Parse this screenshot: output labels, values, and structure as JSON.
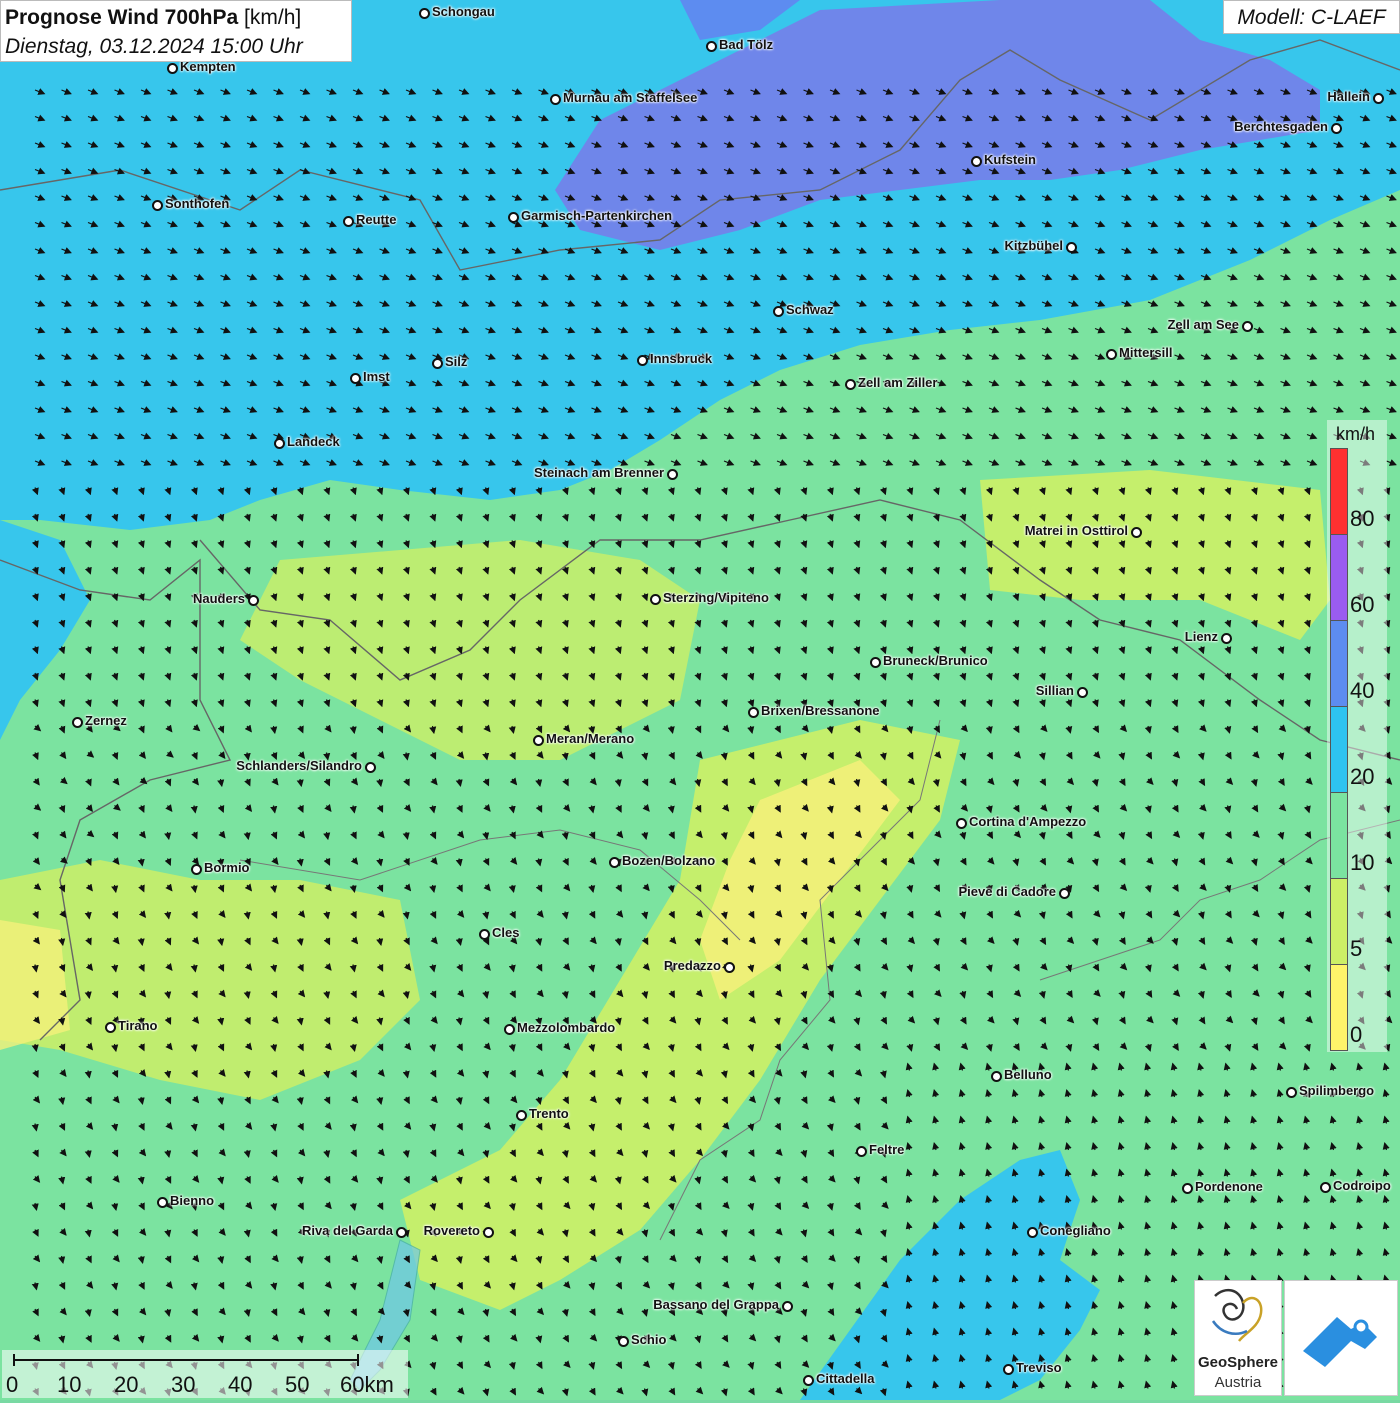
{
  "header": {
    "title_bold": "Prognose Wind 700hPa",
    "title_unit": " [km/h]",
    "datetime": "Dienstag, 03.12.2024 15:00 Uhr",
    "model": "Modell: C-LAEF"
  },
  "legend": {
    "unit": "km/h",
    "ticks": [
      "80",
      "60",
      "40",
      "20",
      "10",
      "5",
      "0"
    ],
    "colors": [
      "#ff3030",
      "#9a5cf0",
      "#5d8cf0",
      "#2ec3f0",
      "#7be3a0",
      "#cdef66",
      "#fff46a"
    ]
  },
  "scale": {
    "labels": [
      "0",
      "10",
      "20",
      "30",
      "40",
      "50",
      "60km"
    ]
  },
  "cities": [
    {
      "name": "Schongau"
    },
    {
      "name": "Bad Tölz"
    },
    {
      "name": "Kempten"
    },
    {
      "name": "Murnau am Staffelsee"
    },
    {
      "name": "Hallein"
    },
    {
      "name": "Berchtesgaden"
    },
    {
      "name": "Kufstein"
    },
    {
      "name": "Sonthofen"
    },
    {
      "name": "Reutte"
    },
    {
      "name": "Garmisch-Partenkirchen"
    },
    {
      "name": "Kitzbühel"
    },
    {
      "name": "Schwaz"
    },
    {
      "name": "Zell am See"
    },
    {
      "name": "Mittersill"
    },
    {
      "name": "Innsbruck"
    },
    {
      "name": "Silz"
    },
    {
      "name": "Imst"
    },
    {
      "name": "Zell am Ziller"
    },
    {
      "name": "Landeck"
    },
    {
      "name": "Steinach am Brenner"
    },
    {
      "name": "Matrei in Osttirol"
    },
    {
      "name": "Nauders"
    },
    {
      "name": "Sterzing/Vipiteno"
    },
    {
      "name": "Lienz"
    },
    {
      "name": "Bruneck/Brunico"
    },
    {
      "name": "Sillian"
    },
    {
      "name": "Brixen/Bressanone"
    },
    {
      "name": "Zernez"
    },
    {
      "name": "Meran/Merano"
    },
    {
      "name": "Schlanders/Silandro"
    },
    {
      "name": "Cortina d'Ampezzo"
    },
    {
      "name": "Bozen/Bolzano"
    },
    {
      "name": "Bormio"
    },
    {
      "name": "Pieve di Cadore"
    },
    {
      "name": "Cles"
    },
    {
      "name": "Predazzo"
    },
    {
      "name": "Tirano"
    },
    {
      "name": "Mezzolombardo"
    },
    {
      "name": "Belluno"
    },
    {
      "name": "Spilimbergo"
    },
    {
      "name": "Trento"
    },
    {
      "name": "Feltre"
    },
    {
      "name": "Pordenone"
    },
    {
      "name": "Codroipo"
    },
    {
      "name": "Bienno"
    },
    {
      "name": "Riva del Garda"
    },
    {
      "name": "Rovereto"
    },
    {
      "name": "Conegliano"
    },
    {
      "name": "Bassano del Grappa"
    },
    {
      "name": "Schio"
    },
    {
      "name": "Treviso"
    },
    {
      "name": "Cittadella"
    }
  ],
  "logos": {
    "geosphere_line1": "GeoSphere",
    "geosphere_line2": "Austria"
  }
}
